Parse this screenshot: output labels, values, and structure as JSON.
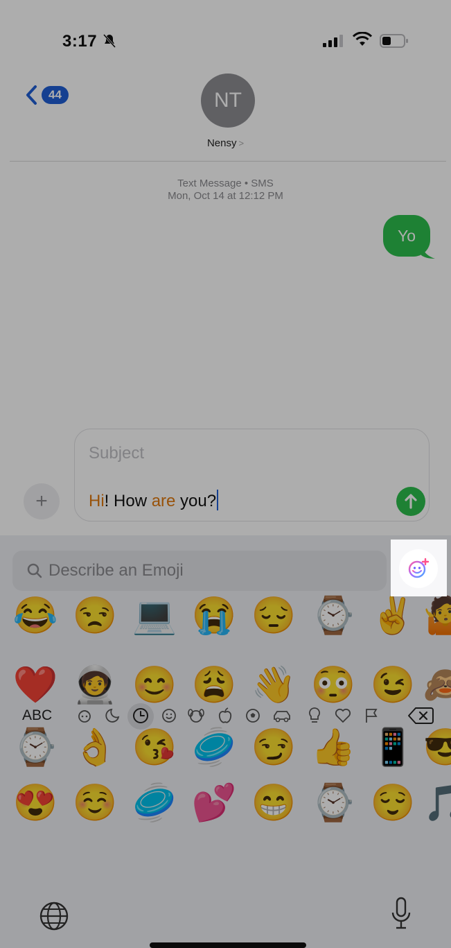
{
  "status_bar": {
    "time": "3:17"
  },
  "header": {
    "back_badge": "44",
    "avatar_initials": "NT",
    "contact_name": "Nensy",
    "contact_chevron": ">"
  },
  "thread": {
    "meta_line1": "Text Message • SMS",
    "meta_line2": "Mon, Oct 14 at 12:12 PM",
    "messages": [
      {
        "from": "me",
        "text": "Yo"
      }
    ]
  },
  "composer": {
    "subject_placeholder": "Subject",
    "msg_part1": "Hi",
    "msg_part2": "! How ",
    "msg_part3": "are",
    "msg_part4": " you?",
    "highlight_color": "#e07a10"
  },
  "emoji_keyboard": {
    "search_placeholder": "Describe an Emoji",
    "genmoji_icon": "genmoji-create-icon",
    "rows": [
      [
        "😂",
        "😒",
        "💻",
        "😭",
        "😔",
        "⌚",
        "✌️",
        "🤷"
      ],
      [
        "❤️",
        "🧑‍🚀",
        "😊",
        "😩",
        "👋",
        "😳",
        "😉",
        "🙈"
      ],
      [
        "⌚",
        "👌",
        "😘",
        "🥏",
        "😏",
        "👍",
        "📱",
        "😎"
      ],
      [
        "😍",
        "☺️",
        "🥏",
        "💕",
        "😁",
        "⌚",
        "😌",
        "🎵"
      ]
    ],
    "abc_label": "ABC",
    "categories": [
      "genmoji-icon",
      "stickers-icon",
      "recent-icon",
      "smileys-icon",
      "animals-icon",
      "food-icon",
      "activity-icon",
      "travel-icon",
      "objects-icon",
      "symbols-icon",
      "flags-icon"
    ],
    "selected_category": "recent-icon"
  },
  "colors": {
    "accent": "#1f5fd6",
    "imessage_green": "#2dbf4d"
  }
}
